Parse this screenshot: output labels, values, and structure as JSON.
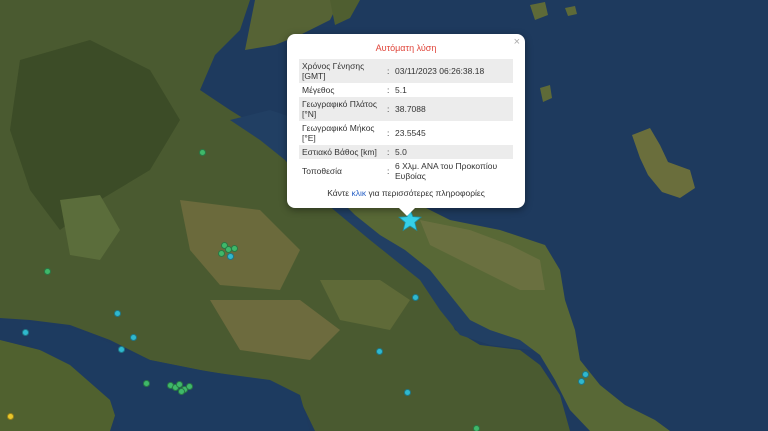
{
  "popup": {
    "title": "Αυτόματη λύση",
    "close_icon": "×",
    "rows": [
      {
        "label": "Χρόνος Γένησης [GMT]",
        "value": "03/11/2023 06:26:38.18"
      },
      {
        "label": "Μέγεθος",
        "value": "5.1"
      },
      {
        "label": "Γεωγραφικό Πλάτος [°N]",
        "value": "38.7088"
      },
      {
        "label": "Γεωγραφικό Μήκος [°E]",
        "value": "23.5545"
      },
      {
        "label": "Εστιακό Βάθος [km]",
        "value": "5.0"
      },
      {
        "label": "Τοποθεσία",
        "value": "6 Χλμ. ΑΝΑ του Προκοπίου Ευβοίας"
      }
    ],
    "separator": ":",
    "more_prefix": "Κάντε ",
    "more_link": "κλικ",
    "more_suffix": " για περισσότερες πληροφορίες"
  },
  "map": {
    "epicenter_icon": "star-icon",
    "epicenter_color": "#35d0e8",
    "quake_colors": {
      "green": "#3fb86a",
      "cyan": "#2fb8cf",
      "yellow": "#e8c72a"
    }
  }
}
